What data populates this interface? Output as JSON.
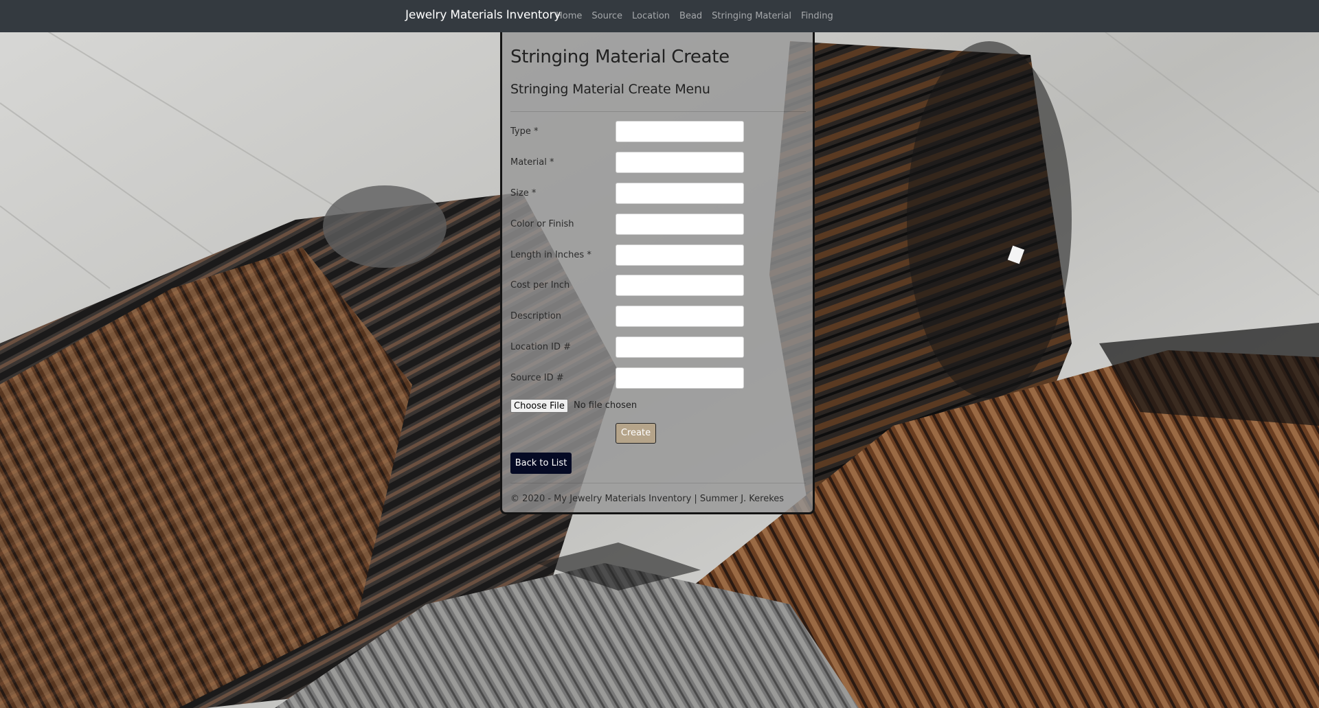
{
  "navbar": {
    "brand": "Jewelry Materials Inventory",
    "links": [
      "Home",
      "Source",
      "Location",
      "Bead",
      "Stringing Material",
      "Finding"
    ]
  },
  "page": {
    "title": "Stringing Material Create",
    "subtitle": "Stringing Material Create Menu"
  },
  "form": {
    "fields": [
      {
        "label": "Type *",
        "value": ""
      },
      {
        "label": "Material *",
        "value": ""
      },
      {
        "label": "Size *",
        "value": ""
      },
      {
        "label": "Color or Finish",
        "value": ""
      },
      {
        "label": "Length in Inches *",
        "value": ""
      },
      {
        "label": "Cost per Inch",
        "value": ""
      },
      {
        "label": "Description",
        "value": ""
      },
      {
        "label": "Location ID #",
        "value": ""
      },
      {
        "label": "Source ID #",
        "value": ""
      }
    ],
    "file_button": "Choose File",
    "file_status": "No file chosen",
    "create_label": "Create"
  },
  "back_link": "Back to List",
  "footer": "© 2020 - My Jewelry Materials Inventory | Summer J. Kerekes",
  "colors": {
    "navbar_bg": "#343a40",
    "create_button": "#b5a48a",
    "back_button": "#050a24"
  }
}
